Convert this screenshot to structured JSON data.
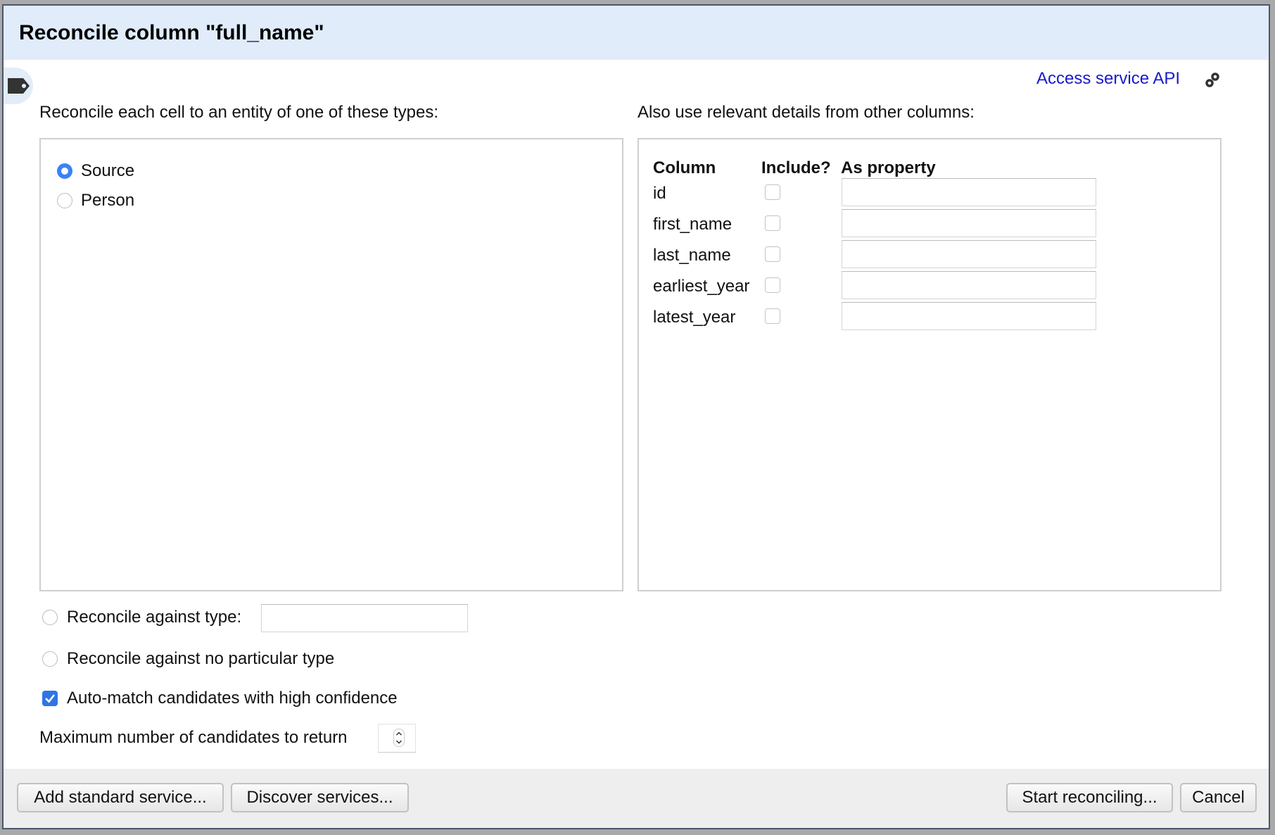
{
  "dialog": {
    "title": "Reconcile column \"full_name\"",
    "access_api_link": "Access service API",
    "types_label": "Reconcile each cell to an entity of one of these types:",
    "types": [
      {
        "label": "Source",
        "selected": true
      },
      {
        "label": "Person",
        "selected": false
      }
    ],
    "other_columns_label": "Also use relevant details from other columns:",
    "columns_table": {
      "headers": [
        "Column",
        "Include?",
        "As property"
      ],
      "rows": [
        {
          "column": "id",
          "include": false,
          "property": ""
        },
        {
          "column": "first_name",
          "include": false,
          "property": ""
        },
        {
          "column": "last_name",
          "include": false,
          "property": ""
        },
        {
          "column": "earliest_year",
          "include": false,
          "property": ""
        },
        {
          "column": "latest_year",
          "include": false,
          "property": ""
        }
      ]
    },
    "against_type_label": "Reconcile against type:",
    "against_type_value": "",
    "no_type_label": "Reconcile against no particular type",
    "auto_match_label": "Auto-match candidates with high confidence",
    "auto_match_checked": true,
    "max_candidates_label": "Maximum number of candidates to return",
    "max_candidates_value": ""
  },
  "footer": {
    "add_standard_service": "Add standard service...",
    "discover_services": "Discover services...",
    "start_reconciling": "Start reconciling...",
    "cancel": "Cancel"
  },
  "colors": {
    "accent": "#3b82f6",
    "header_bg": "#e0ecfa",
    "link": "#1a1acc"
  }
}
